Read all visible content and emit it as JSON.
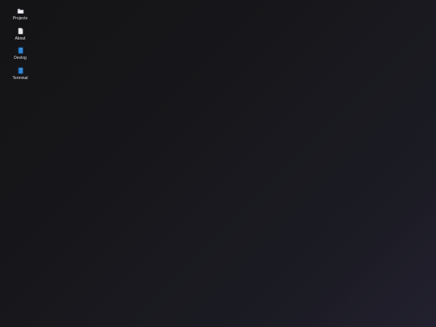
{
  "desktop": {
    "icons": [
      {
        "label": "Projects",
        "icon": "folder-icon"
      },
      {
        "label": "About",
        "icon": "document-icon"
      },
      {
        "label": "Devlog",
        "icon": "blue-book-icon"
      },
      {
        "label": "Terminal",
        "icon": "blue-book-icon"
      }
    ]
  },
  "colors": {
    "background_start": "#141416",
    "background_end": "#22202e",
    "book_blue": "#2f86d6",
    "label_text": "#e8e8ec"
  }
}
